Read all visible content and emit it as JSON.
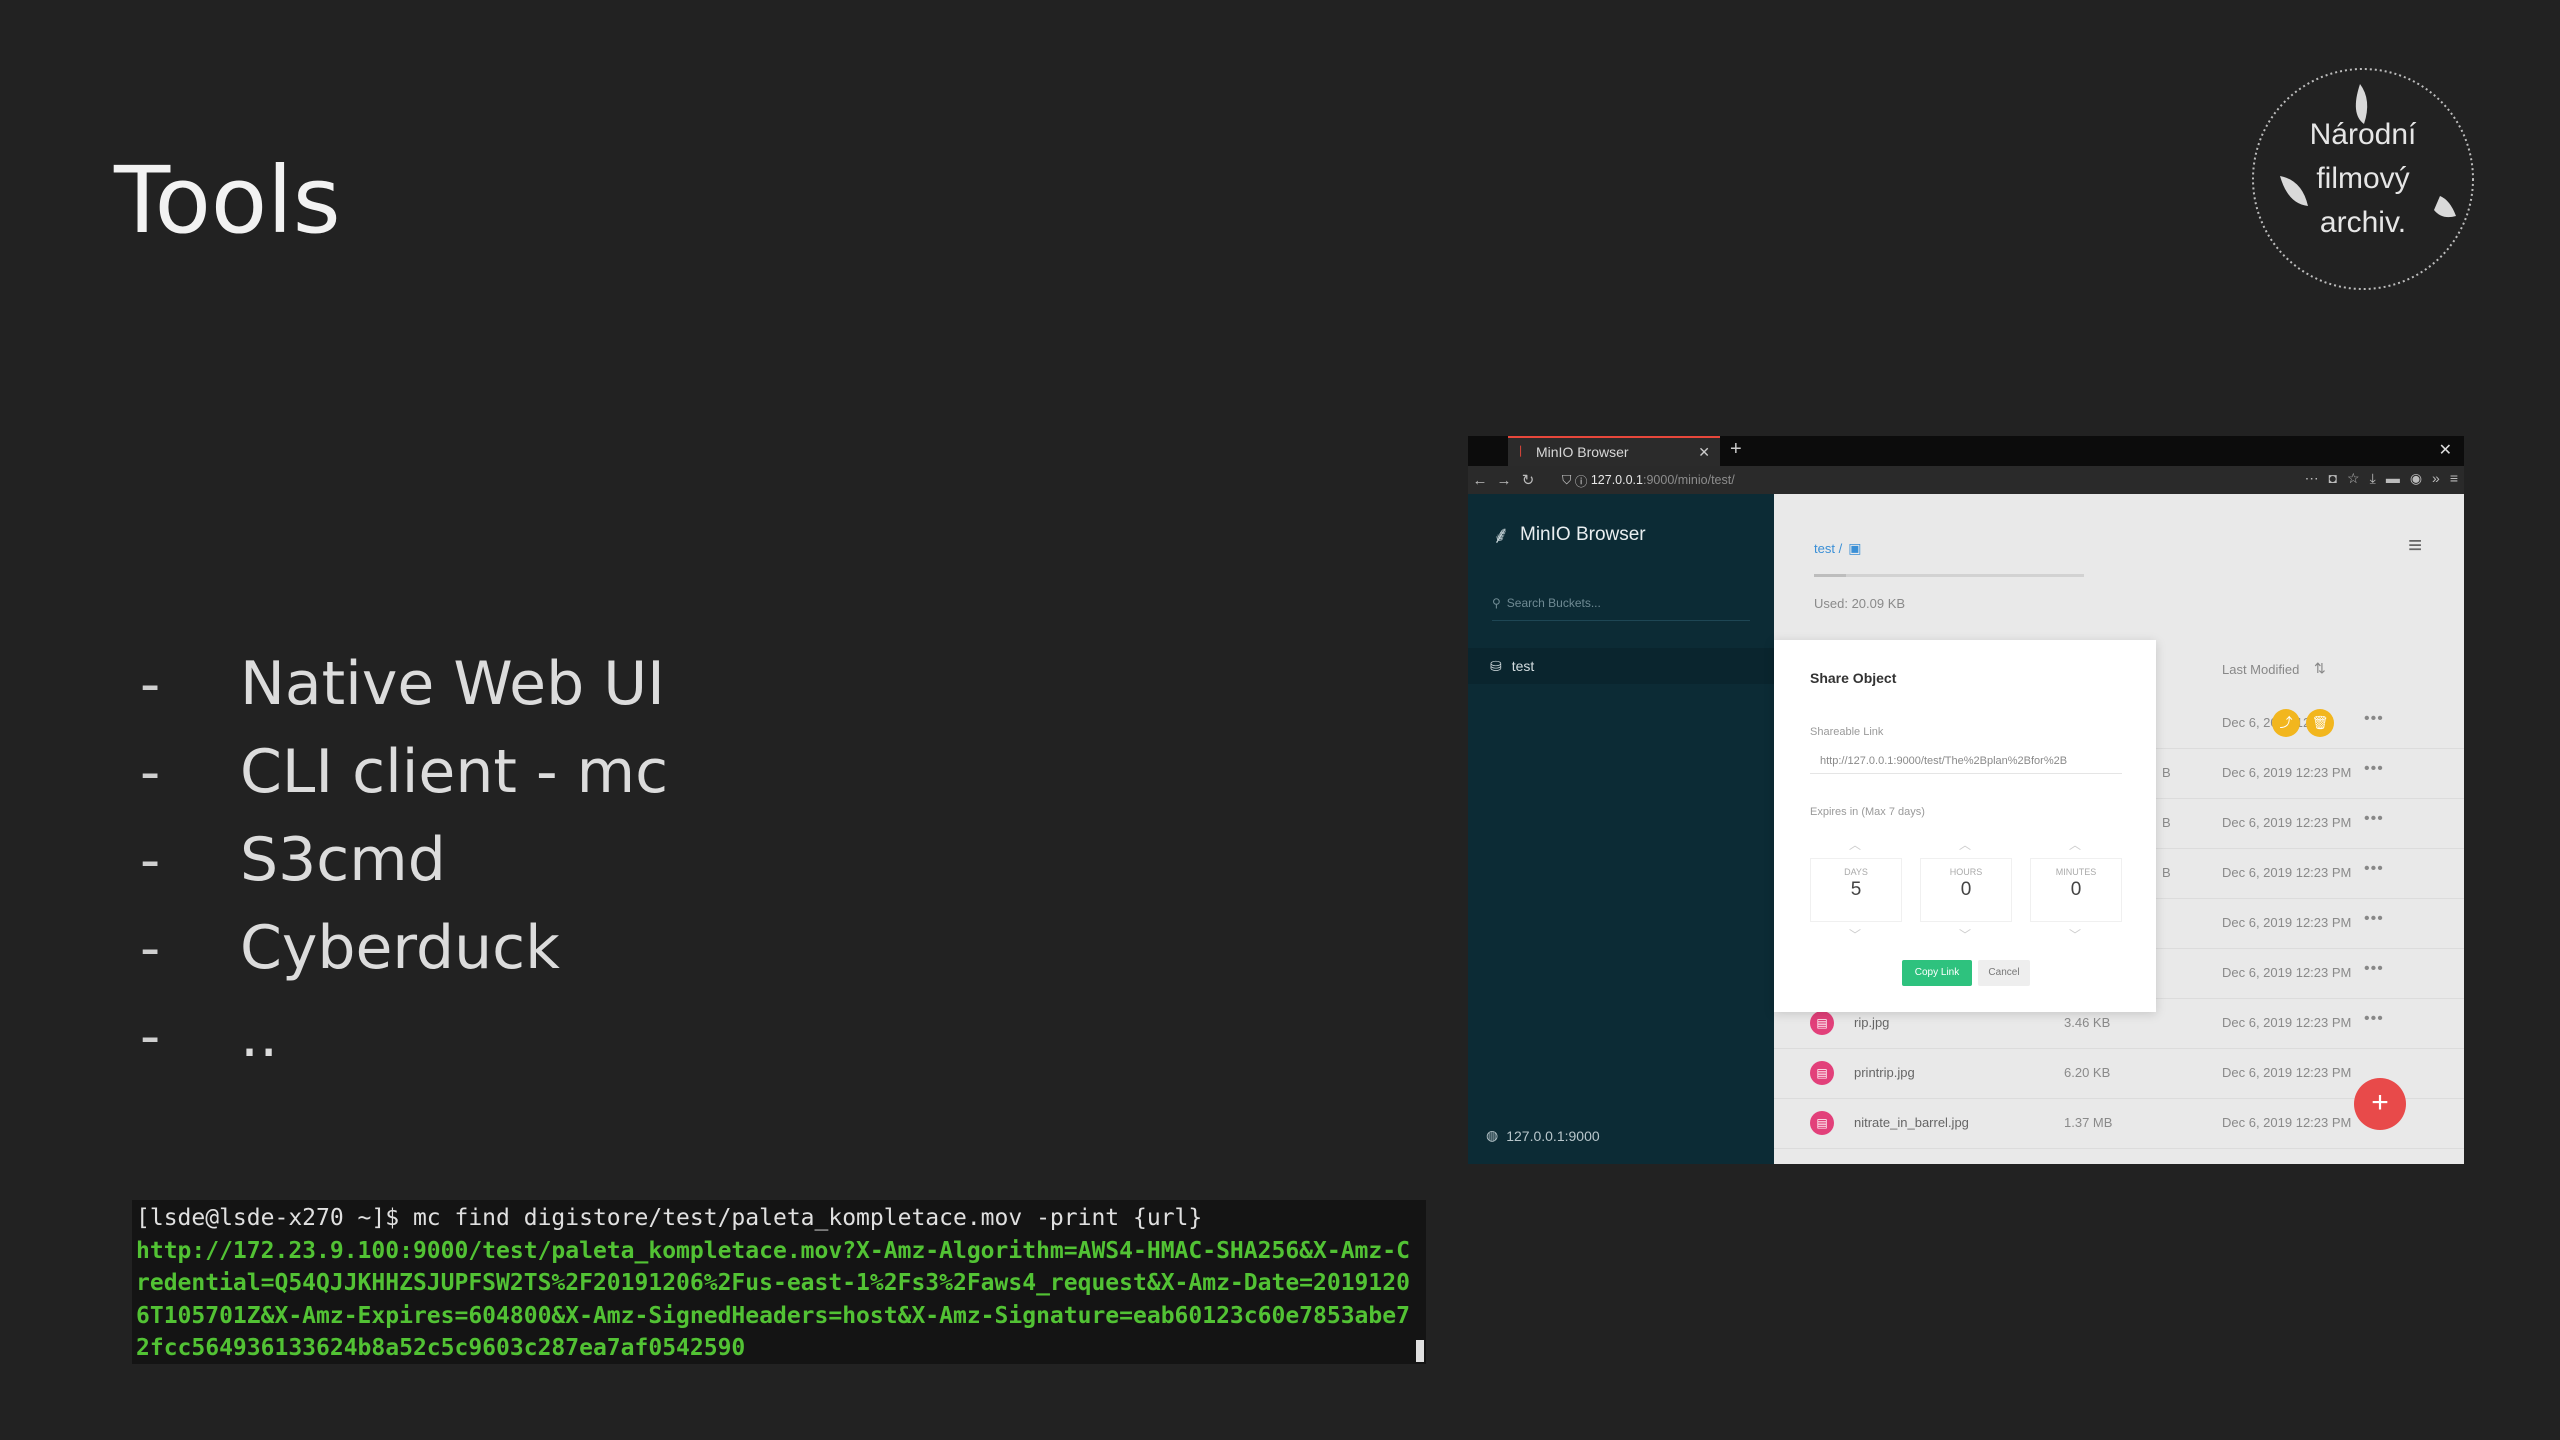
{
  "slide": {
    "title": "Tools",
    "bullets": [
      {
        "dash": "-",
        "text": "Native Web UI"
      },
      {
        "dash": "-",
        "text": "CLI client - mc"
      },
      {
        "dash": "-",
        "text": "S3cmd"
      },
      {
        "dash": "-",
        "text": "Cyberduck"
      },
      {
        "dash": "-",
        "text": ".."
      }
    ]
  },
  "logo": {
    "line1": "Národní",
    "line2": "filmový",
    "line3": "archiv."
  },
  "terminal": {
    "prompt": "[lsde@lsde-x270 ~]$ mc find digistore/test/paleta_kompletace.mov -print {url}",
    "output": "http://172.23.9.100:9000/test/paleta_kompletace.mov?X-Amz-Algorithm=AWS4-HMAC-SHA256&X-Amz-Credential=Q54QJJKHHZSJUPFSW2TS%2F20191206%2Fus-east-1%2Fs3%2Faws4_request&X-Amz-Date=20191206T105701Z&X-Amz-Expires=604800&X-Amz-SignedHeaders=host&X-Amz-Signature=eab60123c60e7853abe72fcc564936133624b8a52c5c9603c287ea7af0542590"
  },
  "browser": {
    "tab_title": "MinIO Browser",
    "url_host": "127.0.0.1",
    "url_path": ":9000/minio/test/",
    "sidebar": {
      "brand": "MinIO Browser",
      "search_placeholder": "Search Buckets...",
      "bucket": "test",
      "host": "127.0.0.1:9000"
    },
    "main": {
      "breadcrumb": "test /",
      "used": "Used: 20.09 KB",
      "usage_fraction": 0.12,
      "col_last_modified": "Last Modified",
      "rows": [
        {
          "name": "",
          "size": "",
          "date": "Dec 6, 2019 12",
          "b": ""
        },
        {
          "name": "",
          "size": "",
          "date": "Dec 6, 2019 12:23 PM",
          "b": "B"
        },
        {
          "name": "",
          "size": "",
          "date": "Dec 6, 2019 12:23 PM",
          "b": "B"
        },
        {
          "name": "",
          "size": "",
          "date": "Dec 6, 2019 12:23 PM",
          "b": "B"
        },
        {
          "name": "",
          "size": "",
          "date": "Dec 6, 2019 12:23 PM",
          "b": ""
        },
        {
          "name": "",
          "size": "",
          "date": "Dec 6, 2019 12:23 PM",
          "b": ""
        },
        {
          "name": "rip.jpg",
          "size": "3.46 KB",
          "date": "Dec 6, 2019 12:23 PM",
          "b": ""
        },
        {
          "name": "printrip.jpg",
          "size": "6.20 KB",
          "date": "Dec 6, 2019 12:23 PM",
          "b": ""
        },
        {
          "name": "nitrate_in_barrel.jpg",
          "size": "1.37 MB",
          "date": "Dec 6, 2019 12:23 PM",
          "b": ""
        }
      ],
      "more_glyph": "•••"
    },
    "modal": {
      "title": "Share Object",
      "link_label": "Shareable Link",
      "link_value": "http://127.0.0.1:9000/test/The%2Bplan%2Bfor%2B",
      "expires_label": "Expires in (Max 7 days)",
      "days_label": "DAYS",
      "days": "5",
      "hours_label": "HOURS",
      "hours": "0",
      "minutes_label": "MINUTES",
      "minutes": "0",
      "copy_label": "Copy Link",
      "cancel_label": "Cancel"
    }
  },
  "colors": {
    "background": "#222222",
    "terminal_url": "#52c234",
    "minio_sidebar": "#0c2b35",
    "accent_share": "#f2b61e",
    "fab": "#e84a4a",
    "copy_button": "#2ec27e"
  }
}
